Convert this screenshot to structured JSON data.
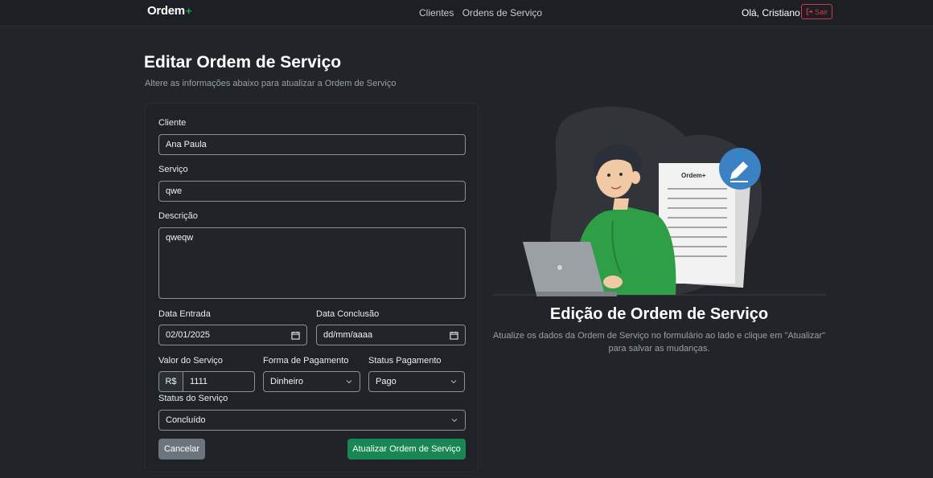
{
  "navbar": {
    "brand": "Ordem",
    "brand_plus": "+",
    "links": [
      "Clientes",
      "Ordens de Serviço"
    ],
    "greeting": "Olá, Cristiano",
    "logout_label": "Sair"
  },
  "header": {
    "title": "Editar Ordem de Serviço",
    "subtitle": "Altere as informações abaixo para atualizar a Ordem de Serviço"
  },
  "form": {
    "cliente_label": "Cliente",
    "cliente_value": "Ana Paula",
    "servico_label": "Serviço",
    "servico_value": "qwe",
    "descricao_label": "Descrição",
    "descricao_value": "qweqw",
    "data_entrada_label": "Data Entrada",
    "data_entrada_value": "02/01/2025",
    "data_conclusao_label": "Data Conclusão",
    "data_conclusao_value": "dd/mm/aaaa",
    "valor_label": "Valor do Serviço",
    "valor_prefix": "R$",
    "valor_value": "1111",
    "forma_pagamento_label": "Forma de Pagamento",
    "forma_pagamento_value": "Dinheiro",
    "status_pagamento_label": "Status Pagamento",
    "status_pagamento_value": "Pago",
    "status_servico_label": "Status do Serviço",
    "status_servico_value": "Concluído",
    "cancel_label": "Cancelar",
    "submit_label": "Atualizar Ordem de Serviço"
  },
  "illustration": {
    "doc_logo": "Ordem+",
    "title": "Edição de Ordem de Serviço",
    "description": "Atualize os dados da Ordem de Serviço no formulário ao lado e clique em \"Atualizar\" para salvar as mudanças."
  },
  "colors": {
    "background": "#212529",
    "primary_green": "#198754",
    "danger": "#dc3545",
    "secondary": "#6c757d",
    "accent_blue": "#3b82c4"
  }
}
